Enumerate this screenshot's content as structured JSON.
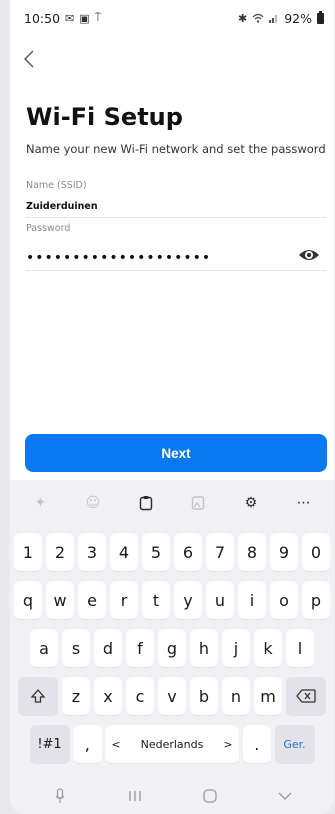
{
  "status_bar": {
    "time": "10:50",
    "left_icons": [
      "message-icon",
      "gallery-icon",
      "antenna-icon"
    ],
    "right_icons": [
      "bluetooth-icon",
      "wifi-icon",
      "signal-icon"
    ],
    "battery": "92%"
  },
  "page": {
    "title": "Wi-Fi Setup",
    "subtitle": "Name your new Wi-Fi network and set the password"
  },
  "form": {
    "ssid_label": "Name (SSID)",
    "ssid_value": "Zuiderduinen",
    "password_label": "Password",
    "password_mask": "••••••••••••••••••••"
  },
  "next_button": "Next",
  "keyboard": {
    "toolbar": [
      "sparkle-icon",
      "emoji-icon",
      "clipboard-icon",
      "image-icon",
      "settings-icon",
      "more-icon"
    ],
    "row_numbers": [
      "1",
      "2",
      "3",
      "4",
      "5",
      "6",
      "7",
      "8",
      "9",
      "0"
    ],
    "row_1": [
      "q",
      "w",
      "e",
      "r",
      "t",
      "y",
      "u",
      "i",
      "o",
      "p"
    ],
    "row_2": [
      "a",
      "s",
      "d",
      "f",
      "g",
      "h",
      "j",
      "k",
      "l"
    ],
    "row_3": [
      "z",
      "x",
      "c",
      "v",
      "b",
      "n",
      "m"
    ],
    "symbols_key": "!#1",
    "comma_key": ",",
    "space_label": "Nederlands",
    "space_left_arrow": "<",
    "space_right_arrow": ">",
    "period_key": ".",
    "enter_key": "Ger."
  },
  "nav_bar": [
    "mic-icon",
    "recents-icon",
    "home-icon",
    "hide-keyboard-icon"
  ]
}
